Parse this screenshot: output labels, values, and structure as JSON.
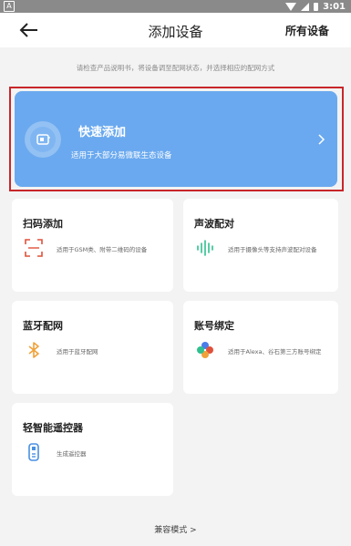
{
  "status_bar": {
    "time": "3:01",
    "icons": [
      "notification-icon",
      "wifi-icon",
      "signal-icon",
      "battery-icon"
    ]
  },
  "header": {
    "back_icon": "arrow-left-icon",
    "title": "添加设备",
    "right_action": "所有设备"
  },
  "hint": "请检查产品说明书，将设备调至配网状态，并选择相应的配网方式",
  "quick_add": {
    "title": "快速添加",
    "subtitle": "适用于大部分易微联生态设备",
    "icon": "device-connect-icon",
    "chevron": "chevron-right-icon",
    "card_color": "#6aa9ef",
    "highlight_border_color": "#c8262a"
  },
  "methods": [
    {
      "title": "扫码添加",
      "description": "适用于GSM类、附带二维码的设备",
      "icon": "scan-frame-icon",
      "icon_color": "#e0513a"
    },
    {
      "title": "声波配对",
      "description": "适用于摄像头等支持声波配对设备",
      "icon": "sound-wave-icon",
      "icon_color": "#2fbf8e"
    },
    {
      "title": "蓝牙配网",
      "description": "适用于蓝牙配网",
      "icon": "bluetooth-icon",
      "icon_color": "#f0a23a"
    },
    {
      "title": "账号绑定",
      "description": "适用于Alexa、谷石第三方账号绑定",
      "icon": "alexa-pinwheel-icon",
      "icon_color": "#4a7de8"
    },
    {
      "title": "轻智能遥控器",
      "description": "生成遥控器",
      "icon": "remote-control-icon",
      "icon_color": "#4a90e2"
    }
  ],
  "footer": {
    "compat_label": "兼容模式",
    "chevron": ">"
  }
}
